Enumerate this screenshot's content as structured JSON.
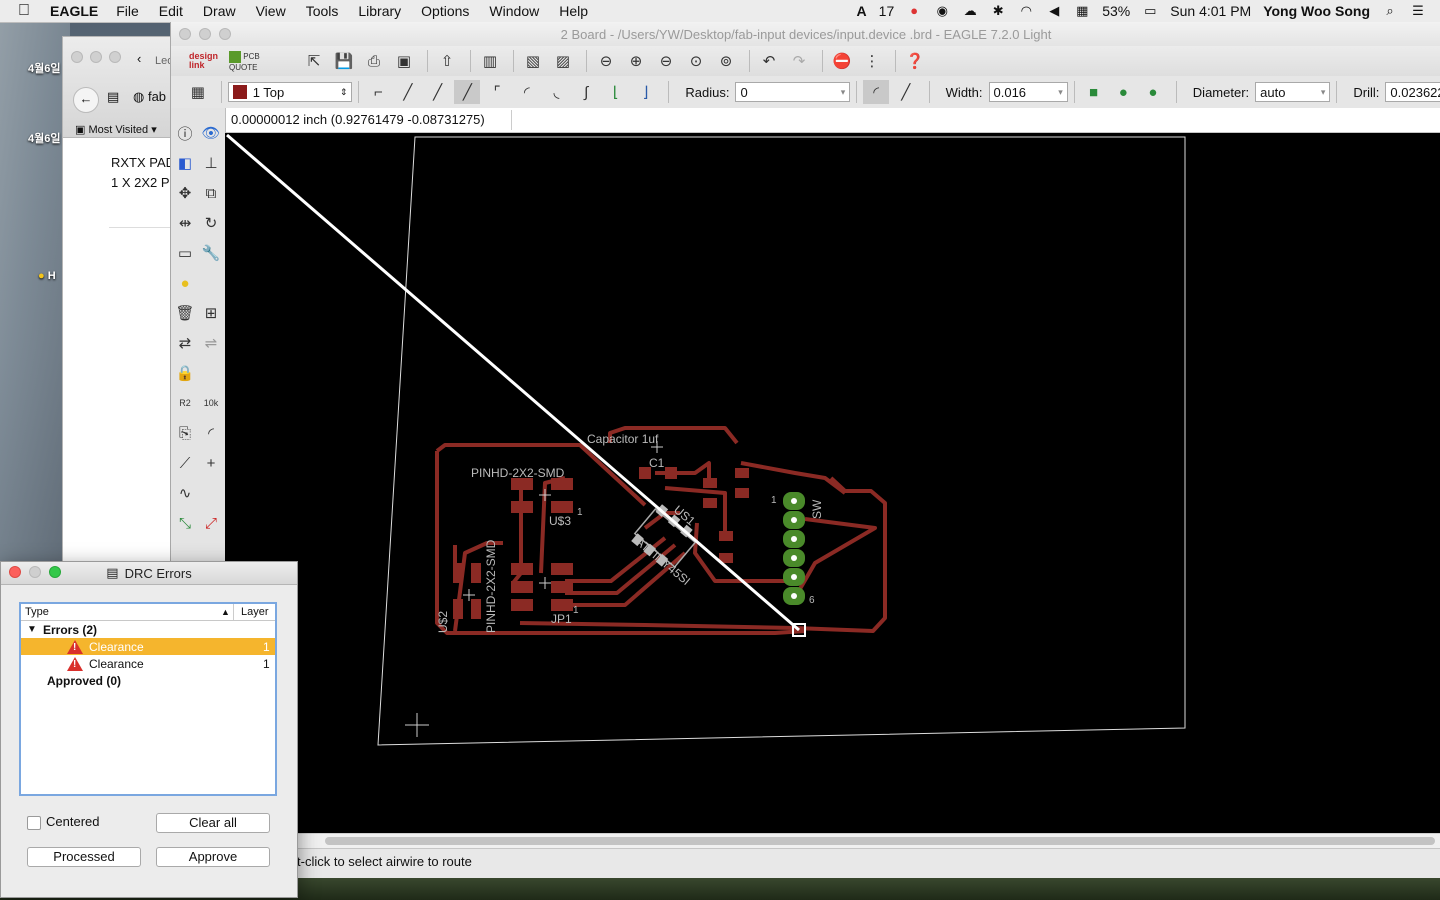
{
  "menubar": {
    "app_name": "EAGLE",
    "menus": [
      "File",
      "Edit",
      "Draw",
      "View",
      "Tools",
      "Library",
      "Options",
      "Window",
      "Help"
    ],
    "status": {
      "notification_count": "17",
      "battery": "53%",
      "clock": "Sun 4:01 PM",
      "user": "Yong Woo Song"
    }
  },
  "desktop": {
    "labels": [
      "4월6일",
      "4월6일",
      "H"
    ]
  },
  "browser": {
    "tab_label": "Leo",
    "address": "fab",
    "bookmark": "Most Visited",
    "content_lines": [
      "RXTX PAD",
      "1 X 2X2 P"
    ]
  },
  "eagle": {
    "window_title": "2 Board - /Users/YW/Desktop/fab-input devices/input.device .brd - EAGLE 7.2.0 Light",
    "toolbar1": {
      "logo_designlink": "design link",
      "logo_pcbquote": "PCB QUOTE"
    },
    "toolbar2": {
      "layer_value": "1 Top",
      "layer_color": "#8b1a1a",
      "radius_label": "Radius:",
      "radius_value": "0",
      "width_label": "Width:",
      "width_value": "0.016",
      "diameter_label": "Diameter:",
      "diameter_value": "auto",
      "drill_label": "Drill:",
      "drill_value": "0.023622"
    },
    "coordinates": "0.00000012 inch (0.92761479 -0.08731275)",
    "status_text": "t-click to select airwire to route",
    "board_labels": {
      "capacitor": "Capacitor 1uf",
      "c1": "C1",
      "pinhd_top": "PINHD-2X2-SMD",
      "us3": "U$3",
      "pin1_a": "1",
      "us1": "US1",
      "attiny": "ATTINY45SI",
      "sw": "SW",
      "pin1_b": "1",
      "pin6": "6",
      "pinhd_left": "PINHD-2X2-SMD",
      "us2": "U$2",
      "jp1": "JP1",
      "pin1_c": "1"
    },
    "trace_color": "#8b2a24",
    "pad_color": "#4a8a2a"
  },
  "drc": {
    "title": "DRC Errors",
    "columns": {
      "type": "Type",
      "layer": "Layer"
    },
    "errors_group": "Errors (2)",
    "errors": [
      {
        "type": "Clearance",
        "layer": "1"
      },
      {
        "type": "Clearance",
        "layer": "1"
      }
    ],
    "approved_group": "Approved (0)",
    "centered_label": "Centered",
    "clear_all_label": "Clear all",
    "processed_label": "Processed",
    "approve_label": "Approve"
  }
}
